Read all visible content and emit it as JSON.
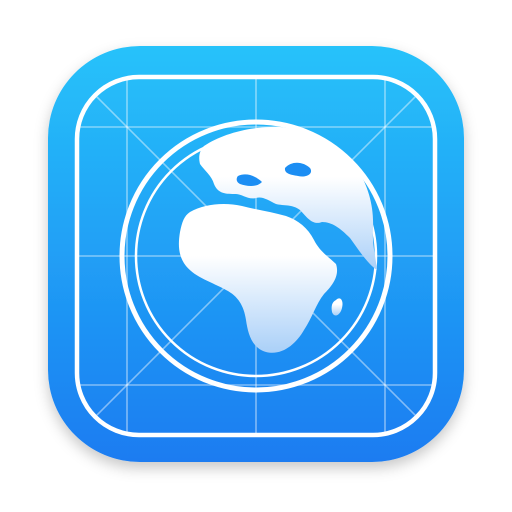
{
  "app_icon": {
    "icon_name": "globe-icon",
    "colors": {
      "gradient_top": "#27C2FA",
      "gradient_bottom": "#1A7CF1",
      "line": "#FFFFFF",
      "globe_fill_top": "#FFFFFF",
      "globe_fill_bottom": "#AAD0F8"
    }
  }
}
